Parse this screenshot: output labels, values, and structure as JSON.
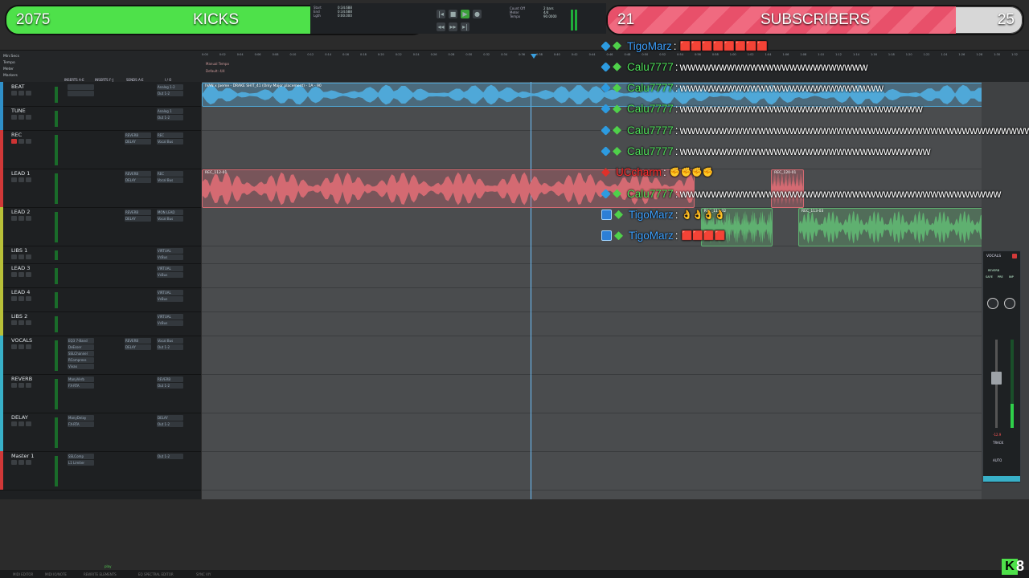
{
  "overlay": {
    "kicks": {
      "count": "2075",
      "label": "KICKS",
      "goal": "2800",
      "fraction": 0.745
    },
    "subs": {
      "count": "21",
      "label": "SUBSCRIBERS",
      "goal": "25",
      "fraction": 0.84
    }
  },
  "transport": {
    "counter_labels": [
      "Start",
      "End",
      "Lgth"
    ],
    "counter_values": [
      "0:34.688",
      "0:34.688",
      "0:00.000"
    ],
    "click_label": "Count Off",
    "meter_label": "Meter",
    "tempo_label": "Tempo",
    "bars_value": "2 bars",
    "meter_value": "4/4",
    "tempo_value": "90.0000"
  },
  "ruler": {
    "rows": [
      "Min:Secs",
      "Tempo",
      "Meter",
      "Markers"
    ],
    "tempo_marker": "Manual Tempo",
    "meter_marker": "Default: 4/4",
    "ticks": [
      "0:00",
      "0:02",
      "0:04",
      "0:06",
      "0:08",
      "0:10",
      "0:12",
      "0:14",
      "0:16",
      "0:18",
      "0:20",
      "0:22",
      "0:24",
      "0:26",
      "0:28",
      "0:30",
      "0:32",
      "0:34",
      "0:36",
      "0:38",
      "0:40",
      "0:42",
      "0:44",
      "0:46",
      "0:48",
      "0:50",
      "0:52",
      "0:54",
      "0:56",
      "0:58",
      "1:00",
      "1:02",
      "1:04",
      "1:06",
      "1:08",
      "1:10",
      "1:12",
      "1:14",
      "1:16",
      "1:18",
      "1:20",
      "1:22",
      "1:24",
      "1:26",
      "1:28",
      "1:30",
      "1:32"
    ]
  },
  "columns": {
    "inserts_ae": "INSERTS A-E",
    "inserts_fj": "INSERTS F-J",
    "sends_ae": "SENDS A-E",
    "io": "I / O"
  },
  "tracks": [
    {
      "name": "BEAT",
      "color": "#2f8fc8",
      "height": 30,
      "plugins": [
        "",
        ""
      ],
      "sends": [],
      "io": [
        "Analog 1-2",
        "Out 1-2"
      ]
    },
    {
      "name": "TUNE",
      "color": "#2f8fc8",
      "height": 30,
      "plugins": [],
      "sends": [],
      "io": [
        "Analog 1",
        "Out 1-2"
      ]
    },
    {
      "name": "REC",
      "color": "#d03838",
      "height": 48,
      "plugins": [],
      "sends": [
        "REVERB",
        "DELAY"
      ],
      "io": [
        "REC",
        "Vocal Bus"
      ]
    },
    {
      "name": "LEAD 1",
      "color": "#d03838",
      "height": 48,
      "plugins": [],
      "sends": [
        "REVERB",
        "DELAY"
      ],
      "io": [
        "REC",
        "Vocal Bus"
      ]
    },
    {
      "name": "LEAD 2",
      "color": "#b8c038",
      "height": 48,
      "plugins": [],
      "sends": [
        "REVERB",
        "DELAY"
      ],
      "io": [
        "MON LEAD",
        "Vocal Bus"
      ]
    },
    {
      "name": "LIBS 1",
      "color": "#b8c038",
      "height": 22,
      "plugins": [],
      "sends": [],
      "io": [
        "VIRTUAL",
        "VcBus"
      ]
    },
    {
      "name": "LEAD 3",
      "color": "#b8c038",
      "height": 30,
      "plugins": [],
      "sends": [],
      "io": [
        "VIRTUAL",
        "VcBus"
      ]
    },
    {
      "name": "LEAD 4",
      "color": "#b8c038",
      "height": 30,
      "plugins": [],
      "sends": [],
      "io": [
        "VIRTUAL",
        "VcBus"
      ]
    },
    {
      "name": "LIBS 2",
      "color": "#b8c038",
      "height": 30,
      "plugins": [],
      "sends": [],
      "io": [
        "VIRTUAL",
        "VcBus"
      ]
    },
    {
      "name": "VOCALS",
      "color": "#38b0c8",
      "height": 48,
      "plugins": [
        "EQ3 7-Band",
        "DeEsser",
        "SSLChannel",
        "RCompress",
        "Vivax"
      ],
      "sends": [
        "REVERB",
        "DELAY"
      ],
      "io": [
        "Vocal Bus",
        "Out 1-2"
      ]
    },
    {
      "name": "REVERB",
      "color": "#38b0c8",
      "height": 48,
      "plugins": [
        "ManyVerb",
        "FX-RTA"
      ],
      "sends": [],
      "io": [
        "REVERB",
        "Out 1-2"
      ]
    },
    {
      "name": "DELAY",
      "color": "#38b0c8",
      "height": 48,
      "plugins": [
        "ManyDelay",
        "FX-RTA"
      ],
      "sends": [],
      "io": [
        "DELAY",
        "Out 1-2"
      ]
    },
    {
      "name": "Master 1",
      "color": "#d03838",
      "height": 48,
      "plugins": [
        "SSLComp",
        "L1 Limiter"
      ],
      "sends": [],
      "io": [
        "Out 1-2"
      ]
    }
  ],
  "regions": [
    {
      "name": "IVAN x Jaeme - DRAKE SHIT_41 (Only Major placement) - 1A - 90",
      "lane": 0,
      "start_frac": 0.0,
      "end_frac": 1.0,
      "color": "#4fa8d8"
    },
    {
      "name": "REC_112-01",
      "lane": 3,
      "start_frac": 0.0,
      "end_frac": 0.63,
      "color": "#d46a72"
    },
    {
      "name": "REC_120-01",
      "lane": 3,
      "start_frac": 0.73,
      "end_frac": 0.77,
      "color": "#d46a72"
    },
    {
      "name": "REC_113-02",
      "lane": 4,
      "start_frac": 0.64,
      "end_frac": 0.73,
      "color": "#5fb070"
    },
    {
      "name": "REC_113-03",
      "lane": 4,
      "start_frac": 0.765,
      "end_frac": 1.0,
      "color": "#5fb070"
    }
  ],
  "mixstrip": {
    "name": "VOCALS",
    "labels": [
      "SAFE",
      "PRE",
      "INP"
    ],
    "send": "REVERB",
    "track_label": "TRACK",
    "auto_label": "AUTO",
    "volume": "-12.9"
  },
  "chat": [
    {
      "user": "TigoMarz",
      "user_color": "#3da1ff",
      "icons": [
        "pin-icon",
        "diamond-icon"
      ],
      "msg": "",
      "emotes": "🟥🟥🟥🟥🟥🟥🟥🟥"
    },
    {
      "user": "Calu7777",
      "user_color": "#4fe05a",
      "icons": [
        "pin-icon",
        "diamond-icon"
      ],
      "msg": "wwwwwwwwwwwwwwwwwwwwwwww"
    },
    {
      "user": "Calu7777",
      "user_color": "#4fe05a",
      "icons": [
        "pin-icon",
        "diamond-icon"
      ],
      "msg": "wwwwwwwwwwwwwwwwwwwwwwwwww"
    },
    {
      "user": "Calu7777",
      "user_color": "#4fe05a",
      "icons": [
        "pin-icon",
        "diamond-icon"
      ],
      "msg": "wwwwwwwwwwwwwwwwwwwwwwwwwwwwwww"
    },
    {
      "user": "Calu7777",
      "user_color": "#4fe05a",
      "icons": [
        "pin-icon",
        "diamond-icon"
      ],
      "msg": "wwwwwwwwwwwwwwwwwwwwwwwwwwwwwwwwwwwwwwwwwwwwwww"
    },
    {
      "user": "Calu7777",
      "user_color": "#4fe05a",
      "icons": [
        "pin-icon",
        "diamond-icon"
      ],
      "msg": "wwwwwwwwwwwwwwwwwwwwwwwwwwwwwwww"
    },
    {
      "user": "UCcharm",
      "user_color": "#ff2b2b",
      "icons": [
        "red-icon"
      ],
      "msg": "",
      "emotes": "✊✊✊✊"
    },
    {
      "user": "Calu7777",
      "user_color": "#4fe05a",
      "icons": [
        "pin-icon",
        "diamond-icon"
      ],
      "msg": "wwwwwwwwwwwwwwwwwwwwwwwwwwwwwwwwwwwwwwwww"
    },
    {
      "user": "TigoMarz",
      "user_color": "#3da1ff",
      "icons": [
        "square-icon",
        "diamond-icon"
      ],
      "msg": "",
      "emotes": "👌👌👌👌"
    },
    {
      "user": "TigoMarz",
      "user_color": "#3da1ff",
      "icons": [
        "square-icon",
        "diamond-icon"
      ],
      "msg": "",
      "emotes": "🟥🟥🟥🟥"
    }
  ],
  "bottom_tabs": [
    "MIDI EDITOR",
    "MIDI IO/NOTE",
    "REWRITE ELEMENTS",
    "EQ SPECTRAL EDITOR",
    "SYNC VIY"
  ],
  "bottom_status": "play",
  "kick_badge": {
    "letter": "K",
    "count": "8"
  }
}
